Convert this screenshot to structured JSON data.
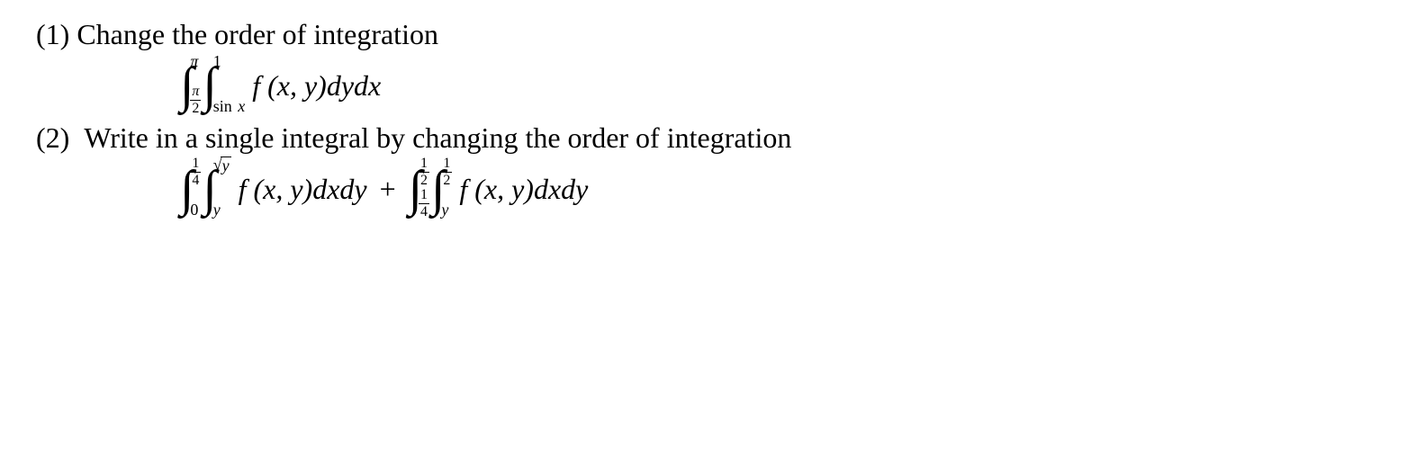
{
  "problem1": {
    "label": "(1)",
    "prompt": "Change the order of integration",
    "int1_upper": "π",
    "int1_lower_num": "π",
    "int1_lower_den": "2",
    "int2_upper": "1",
    "int2_lower_pre": "sin",
    "int2_lower_var": "x",
    "integrand": "f (x, y)dydx"
  },
  "problem2": {
    "label": "(2)",
    "prompt": "Write in a single integral by changing the order of integration",
    "term1": {
      "int1_upper_num": "1",
      "int1_upper_den": "4",
      "int1_lower": "0",
      "int2_upper_sqrt": "y",
      "int2_lower": "y",
      "integrand": "f (x, y)dxdy"
    },
    "plus": "+",
    "term2": {
      "int1_upper_num": "1",
      "int1_upper_den": "2",
      "int1_lower_num": "1",
      "int1_lower_den": "4",
      "int2_upper_num": "1",
      "int2_upper_den": "2",
      "int2_lower": "y",
      "integrand": "f (x, y)dxdy"
    }
  }
}
